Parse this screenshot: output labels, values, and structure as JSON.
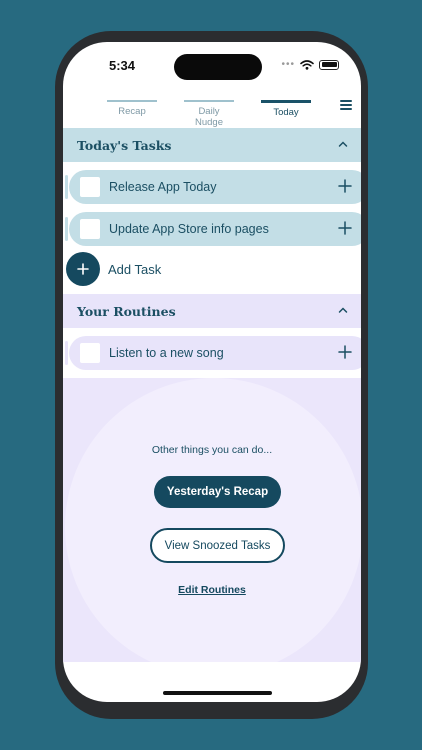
{
  "status_bar": {
    "time": "5:34",
    "more": "•••"
  },
  "tabs": [
    {
      "label": "Recap",
      "active": false
    },
    {
      "label": "Daily Nudge",
      "active": false
    },
    {
      "label": "Today",
      "active": true
    }
  ],
  "todays_tasks": {
    "title": "Today's Tasks",
    "items": [
      {
        "label": "Release App Today"
      },
      {
        "label": "Update App Store info pages"
      }
    ],
    "add_label": "Add Task"
  },
  "routines": {
    "title": "Your Routines",
    "items": [
      {
        "label": "Listen to a  new song"
      }
    ]
  },
  "other": {
    "prompt": "Other things you can do...",
    "recap_button": "Yesterday's Recap",
    "snoozed_button": "View Snoozed Tasks",
    "edit_link": "Edit Routines"
  },
  "colors": {
    "background": "#276a80",
    "primary": "#15495f",
    "tasks_header": "#c3dee6",
    "task_row": "#c3dee6",
    "routines_header": "#e8e4fa",
    "routine_row": "#e8e4fa"
  },
  "icons": [
    "menu-icon",
    "chevron-up-icon",
    "plus-icon",
    "wifi-icon",
    "battery-icon"
  ]
}
